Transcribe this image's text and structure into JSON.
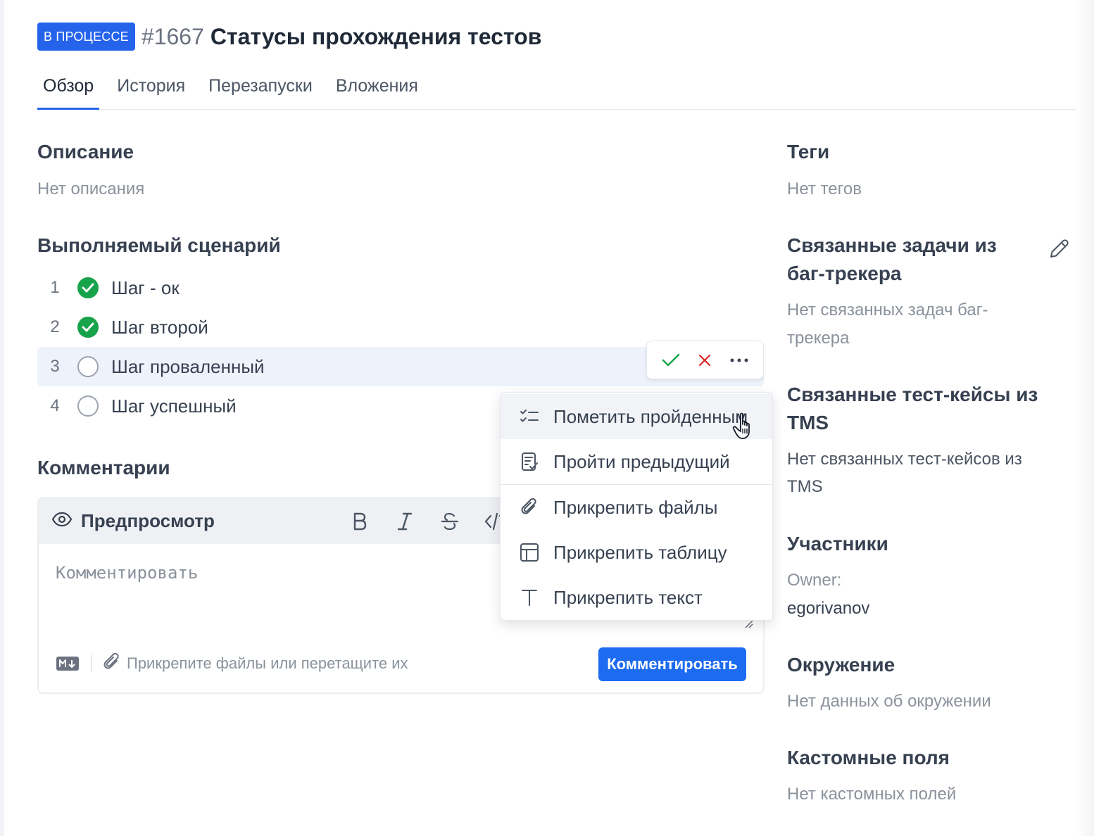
{
  "header": {
    "status": "В ПРОЦЕССЕ",
    "issue_id": "#1667",
    "title": "Статусы прохождения тестов"
  },
  "tabs": [
    {
      "label": "Обзор",
      "active": true
    },
    {
      "label": "История",
      "active": false
    },
    {
      "label": "Перезапуски",
      "active": false
    },
    {
      "label": "Вложения",
      "active": false
    }
  ],
  "description": {
    "title": "Описание",
    "value": "Нет описания"
  },
  "scenario": {
    "title": "Выполняемый сценарий",
    "steps": [
      {
        "num": "1",
        "label": "Шаг - ок",
        "status": "passed"
      },
      {
        "num": "2",
        "label": "Шаг второй",
        "status": "passed"
      },
      {
        "num": "3",
        "label": "Шаг проваленный",
        "status": "pending"
      },
      {
        "num": "4",
        "label": "Шаг успешный",
        "status": "pending"
      }
    ]
  },
  "step_actions": {
    "icons": [
      "check-icon",
      "close-icon",
      "more-icon"
    ]
  },
  "step_menu": {
    "items": [
      {
        "label": "Пометить пройденным",
        "icon": "checklist-icon"
      },
      {
        "label": "Пройти предыдущий",
        "icon": "document-check-icon"
      },
      {
        "label": "Прикрепить файлы",
        "icon": "paperclip-icon"
      },
      {
        "label": "Прикрепить таблицу",
        "icon": "table-icon"
      },
      {
        "label": "Прикрепить текст",
        "icon": "text-icon"
      }
    ]
  },
  "comments": {
    "title": "Комментарии",
    "preview_label": "Предпросмотр",
    "placeholder": "Комментировать",
    "attach_text": "Прикрепите файлы или перетащите их",
    "submit_label": "Комментировать",
    "format_buttons": [
      "bold-icon",
      "italic-icon",
      "strikethrough-icon",
      "code-icon"
    ]
  },
  "sidebar": {
    "tags": {
      "title": "Теги",
      "value": "Нет тегов"
    },
    "bug_tracker": {
      "title_line1": "Связанные задачи из",
      "title_line2": "баг-трекера",
      "value_line1": "Нет связанных задач баг-",
      "value_line2": "трекера"
    },
    "tms": {
      "title_line1": "Связанные тест-кейсы из",
      "title_line2": "TMS",
      "value_line1": "Нет связанных тест-кейсов из",
      "value_line2": "TMS"
    },
    "participants": {
      "title": "Участники",
      "owner_label": "Owner:",
      "owner_value": "egorivanov"
    },
    "environment": {
      "title": "Окружение",
      "value": "Нет данных об окружении"
    },
    "custom_fields": {
      "title": "Кастомные поля",
      "value": "Нет кастомных полей"
    }
  },
  "colors": {
    "accent": "#2563eb",
    "success": "#16a34a",
    "danger": "#dc2626",
    "hover_row": "#eef2fb"
  }
}
